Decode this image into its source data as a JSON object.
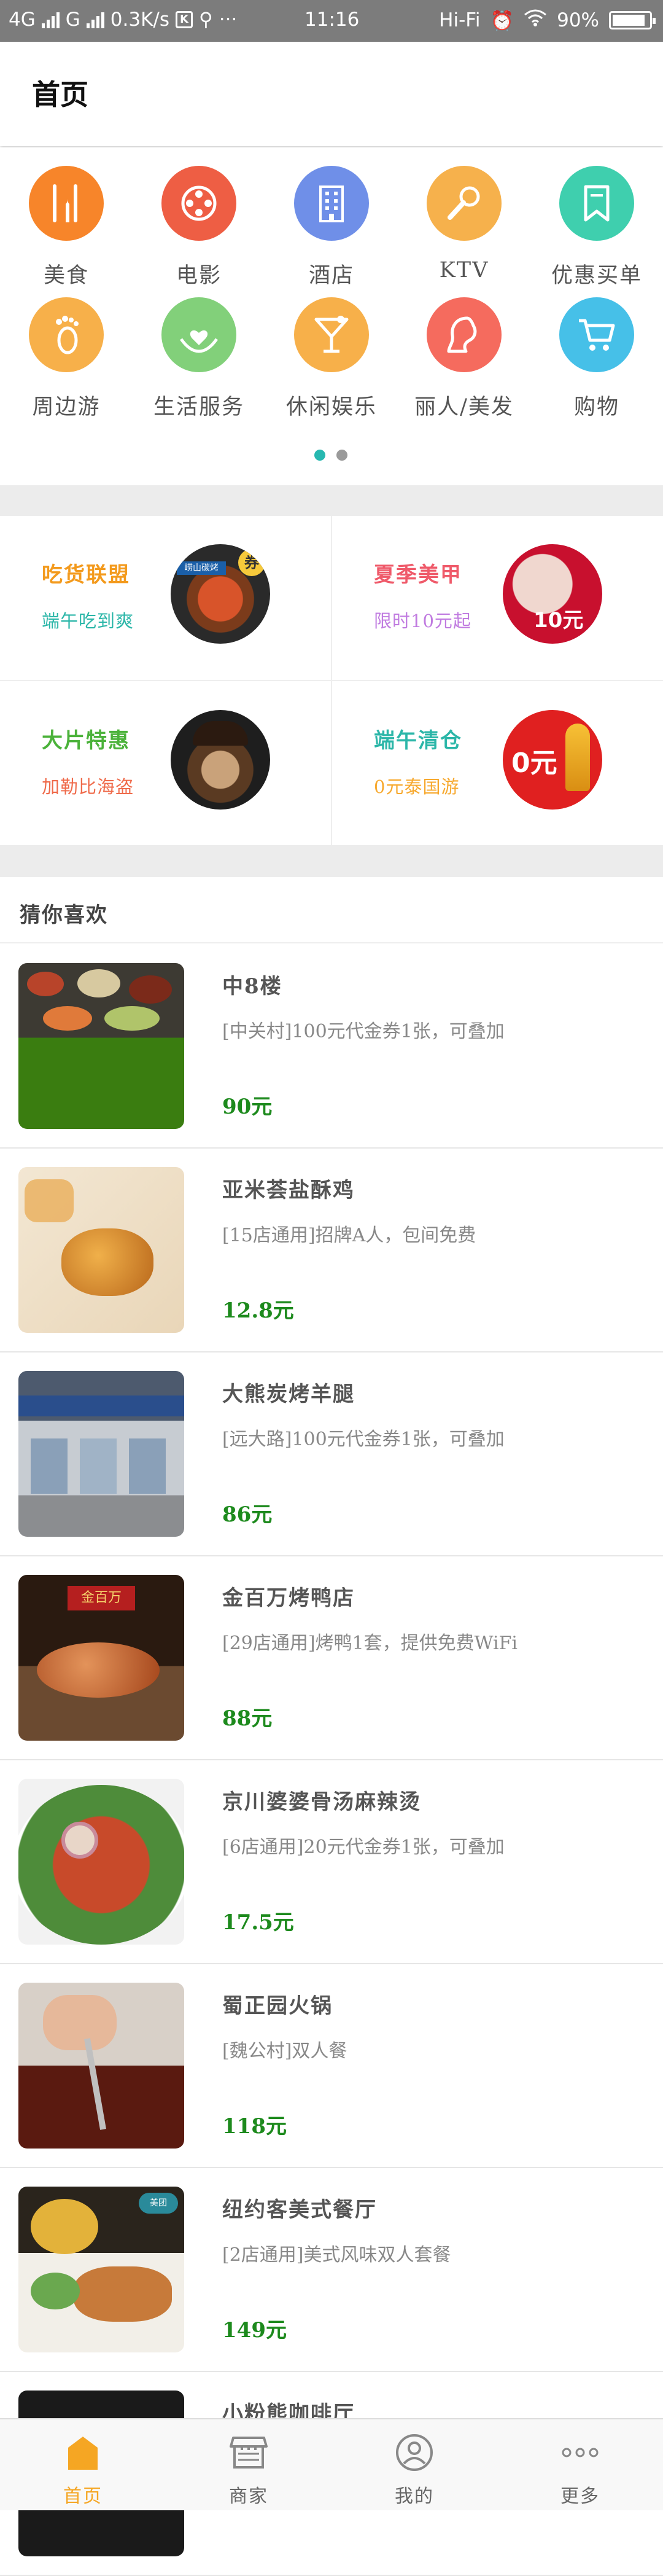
{
  "status_bar": {
    "network_left": "4G",
    "network_mid": "G",
    "speed": "0.3K/s",
    "dots": "···",
    "time": "11:16",
    "wifi_label": "Hi-Fi",
    "battery": "90%",
    "battery_level": 0.9
  },
  "header": {
    "title": "首页"
  },
  "categories": [
    {
      "label": "美食",
      "icon": "fork-knife-icon",
      "color": "#f7852a"
    },
    {
      "label": "电影",
      "icon": "film-reel-icon",
      "color": "#ee5e44"
    },
    {
      "label": "酒店",
      "icon": "building-icon",
      "color": "#6f8fe8"
    },
    {
      "label": "KTV",
      "icon": "microphone-icon",
      "color": "#f6b14c"
    },
    {
      "label": "优惠买单",
      "icon": "bookmark-icon",
      "color": "#3fcfae"
    },
    {
      "label": "周边游",
      "icon": "footprint-icon",
      "color": "#f7b04a"
    },
    {
      "label": "生活服务",
      "icon": "hand-heart-icon",
      "color": "#82d07a"
    },
    {
      "label": "休闲娱乐",
      "icon": "cocktail-icon",
      "color": "#f7b04a"
    },
    {
      "label": "丽人/美发",
      "icon": "woman-profile-icon",
      "color": "#f56b5e"
    },
    {
      "label": "购物",
      "icon": "shopping-cart-icon",
      "color": "#46c0e8"
    }
  ],
  "pager": {
    "pages": 2,
    "active": 0
  },
  "promotions": [
    {
      "name": "吃货联盟",
      "sub": "端午吃到爽",
      "name_color": "#f39a1d",
      "sub_color": "#2bb6a8",
      "image": "food-platter-image",
      "badge": "券"
    },
    {
      "name": "夏季美甲",
      "sub": "限时10元起",
      "name_color": "#ef5a6a",
      "sub_color": "#c07be0",
      "image": "manicure-image",
      "badge": "10元"
    },
    {
      "name": "大片特惠",
      "sub": "加勒比海盗",
      "name_color": "#4bb23a",
      "sub_color": "#ef6a4a",
      "image": "pirate-poster-image",
      "badge": ""
    },
    {
      "name": "端午清仓",
      "sub": "0元泰国游",
      "name_color": "#2bb6a8",
      "sub_color": "#f7a92f",
      "image": "thailand-travel-image",
      "badge": "0元"
    }
  ],
  "guess_section": {
    "title": "猜你喜欢"
  },
  "items": [
    {
      "name": "中8楼",
      "desc": "[中关村]100元代金券1张，可叠加",
      "price": "90元",
      "image": "chinese-dishes-photo"
    },
    {
      "name": "亚米荟盐酥鸡",
      "desc": "[15店通用]招牌A人，包间免费",
      "price": "12.8元",
      "image": "fried-chicken-photo"
    },
    {
      "name": "大熊炭烤羊腿",
      "desc": "[远大路]100元代金券1张，可叠加",
      "price": "86元",
      "image": "restaurant-storefront-photo"
    },
    {
      "name": "金百万烤鸭店",
      "desc": "[29店通用]烤鸭1套，提供免费WiFi",
      "price": "88元",
      "image": "roast-duck-photo"
    },
    {
      "name": "京川婆婆骨汤麻辣烫",
      "desc": "[6店通用]20元代金券1张，可叠加",
      "price": "17.5元",
      "image": "spicy-hotpot-bowl-photo"
    },
    {
      "name": "蜀正园火锅",
      "desc": "[魏公村]双人餐",
      "price": "118元",
      "image": "hotpot-ladle-photo"
    },
    {
      "name": "纽约客美式餐厅",
      "desc": "[2店通用]美式风味双人套餐",
      "price": "149元",
      "image": "american-steak-photo"
    },
    {
      "name": "小粉熊咖啡厅",
      "desc": "",
      "price": "",
      "image": "cafe-photo"
    }
  ],
  "tabbar": [
    {
      "label": "首页",
      "icon": "home-icon",
      "active": true
    },
    {
      "label": "商家",
      "icon": "storefront-icon",
      "active": false
    },
    {
      "label": "我的",
      "icon": "user-profile-icon",
      "active": false
    },
    {
      "label": "更多",
      "icon": "more-dots-icon",
      "active": false
    }
  ],
  "colors": {
    "accent": "#f5a623",
    "price": "#1d8a1d",
    "pager_active": "#27b8b0"
  }
}
